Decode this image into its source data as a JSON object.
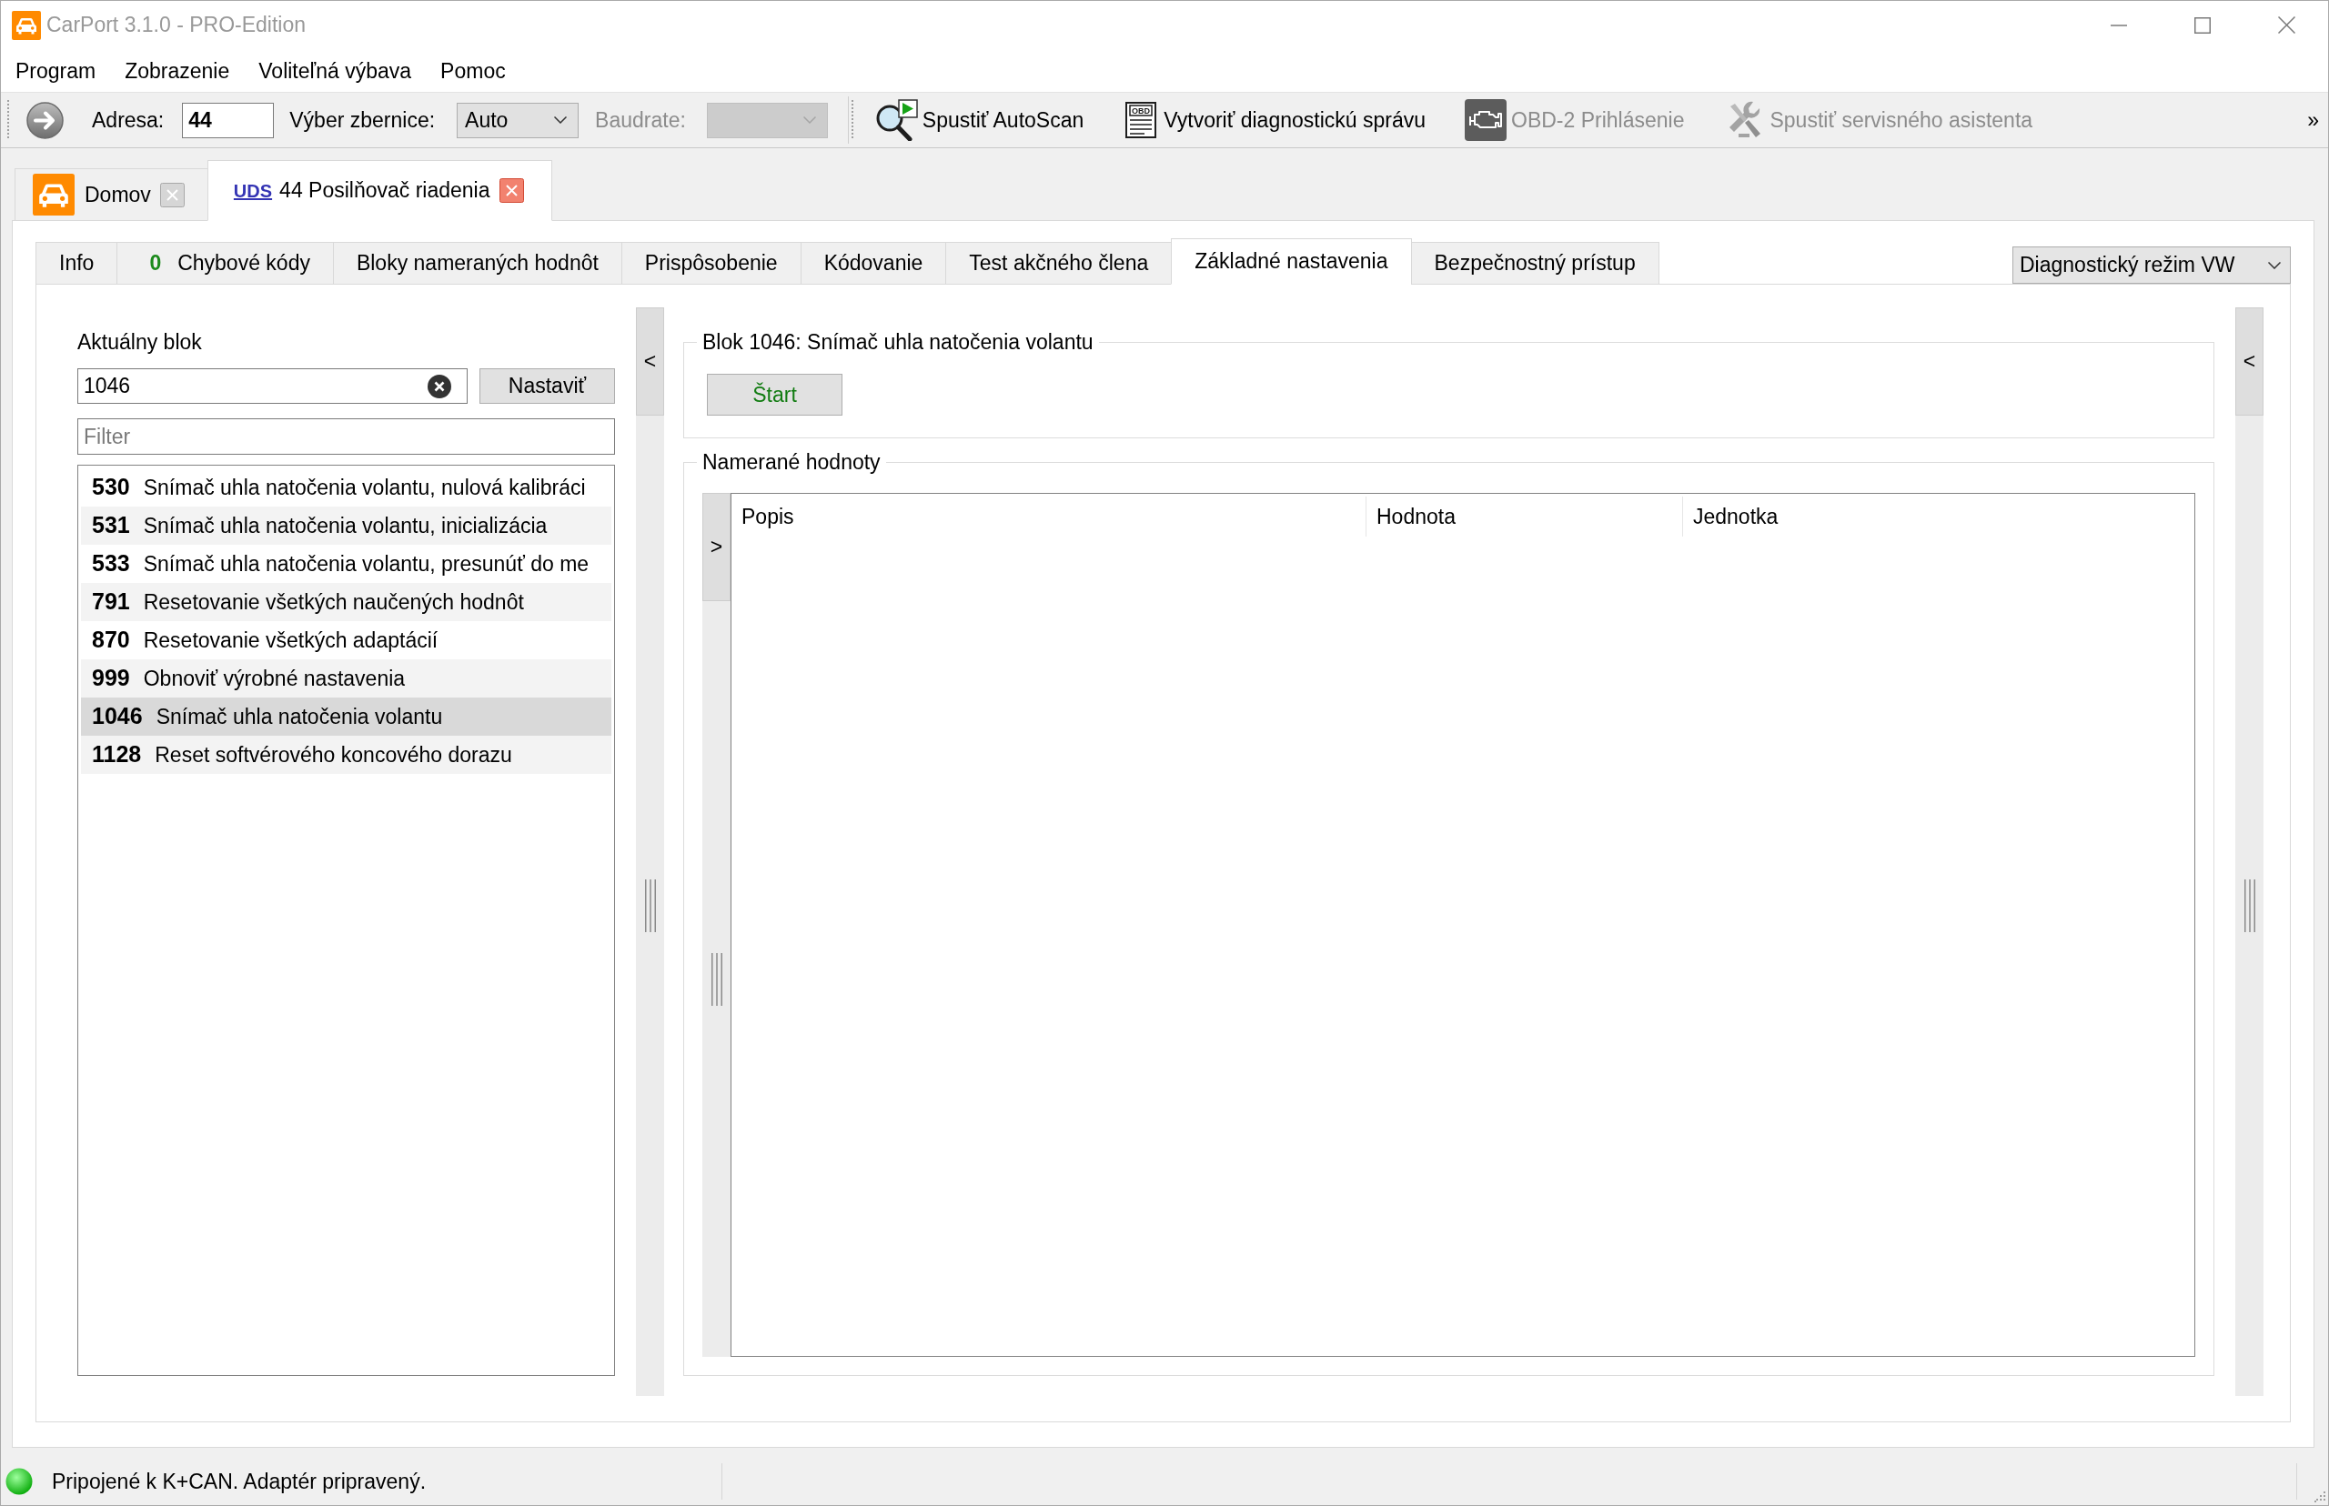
{
  "window": {
    "title": "CarPort 3.1.0 - PRO-Edition",
    "active": false
  },
  "menu": [
    "Program",
    "Zobrazenie",
    "Voliteľná výbava",
    "Pomoc"
  ],
  "toolbar": {
    "address": {
      "label": "Adresa:",
      "value": "44"
    },
    "bus": {
      "label": "Výber zbernice:",
      "value": "Auto"
    },
    "baudrate": {
      "label": "Baudrate:",
      "disabled": true
    },
    "actions": [
      {
        "kind": "autoscan",
        "label": "Spustiť AutoScan",
        "disabled": false
      },
      {
        "kind": "report",
        "label": "Vytvoriť diagnostickú správu",
        "icon_text": "OBD",
        "disabled": false
      },
      {
        "kind": "engine",
        "label": "OBD-2 Prihlásenie",
        "disabled": true
      },
      {
        "kind": "service",
        "label": "Spustiť servisného asistenta",
        "disabled": true
      }
    ],
    "overflow": "»"
  },
  "document_tabs": [
    {
      "kind": "home",
      "label": "Domov",
      "selected": false
    },
    {
      "kind": "module",
      "protocol": "UDS",
      "label": "44 Posilňovač riadenia",
      "selected": true
    }
  ],
  "module_tabs": [
    {
      "label": "Info",
      "selected": false
    },
    {
      "label": "Chybové kódy",
      "count": "0",
      "selected": false
    },
    {
      "label": "Bloky nameraných hodnôt",
      "selected": false
    },
    {
      "label": "Prispôsobenie",
      "selected": false
    },
    {
      "label": "Kódovanie",
      "selected": false
    },
    {
      "label": "Test akčného člena",
      "selected": false
    },
    {
      "label": "Základné nastavenia",
      "selected": true
    },
    {
      "label": "Bezpečnostný prístup",
      "selected": false
    }
  ],
  "mode_select": {
    "value": "Diagnostický režim VW"
  },
  "current_block": {
    "label": "Aktuálny blok",
    "value": "1046",
    "button": "Nastaviť"
  },
  "filter": {
    "placeholder": "Filter"
  },
  "blocks": [
    {
      "number": "530",
      "name": "Snímač uhla natočenia volantu, nulová kalibráci",
      "selected": false
    },
    {
      "number": "531",
      "name": "Snímač uhla natočenia volantu, inicializácia",
      "selected": false
    },
    {
      "number": "533",
      "name": "Snímač uhla natočenia volantu, presunúť do me",
      "selected": false
    },
    {
      "number": "791",
      "name": "Resetovanie všetkých naučených hodnôt",
      "selected": false
    },
    {
      "number": "870",
      "name": "Resetovanie všetkých adaptácií",
      "selected": false
    },
    {
      "number": "999",
      "name": "Obnoviť výrobné nastavenia",
      "selected": false
    },
    {
      "number": "1046",
      "name": "Snímač uhla natočenia volantu",
      "selected": true
    },
    {
      "number": "1128",
      "name": "Reset softvérového koncového dorazu",
      "selected": false
    }
  ],
  "left_toggle": "<",
  "block_group": {
    "title": "Blok 1046: Snímač uhla natočenia volantu",
    "button": "Štart"
  },
  "values_group": {
    "title": "Namerané hodnoty",
    "toggle": ">",
    "columns": [
      "Popis",
      "Hodnota",
      "Jednotka"
    ]
  },
  "right_toggle": "<",
  "status_bar": {
    "connected": true,
    "text": "Pripojené k K+CAN. Adaptér pripravený."
  }
}
